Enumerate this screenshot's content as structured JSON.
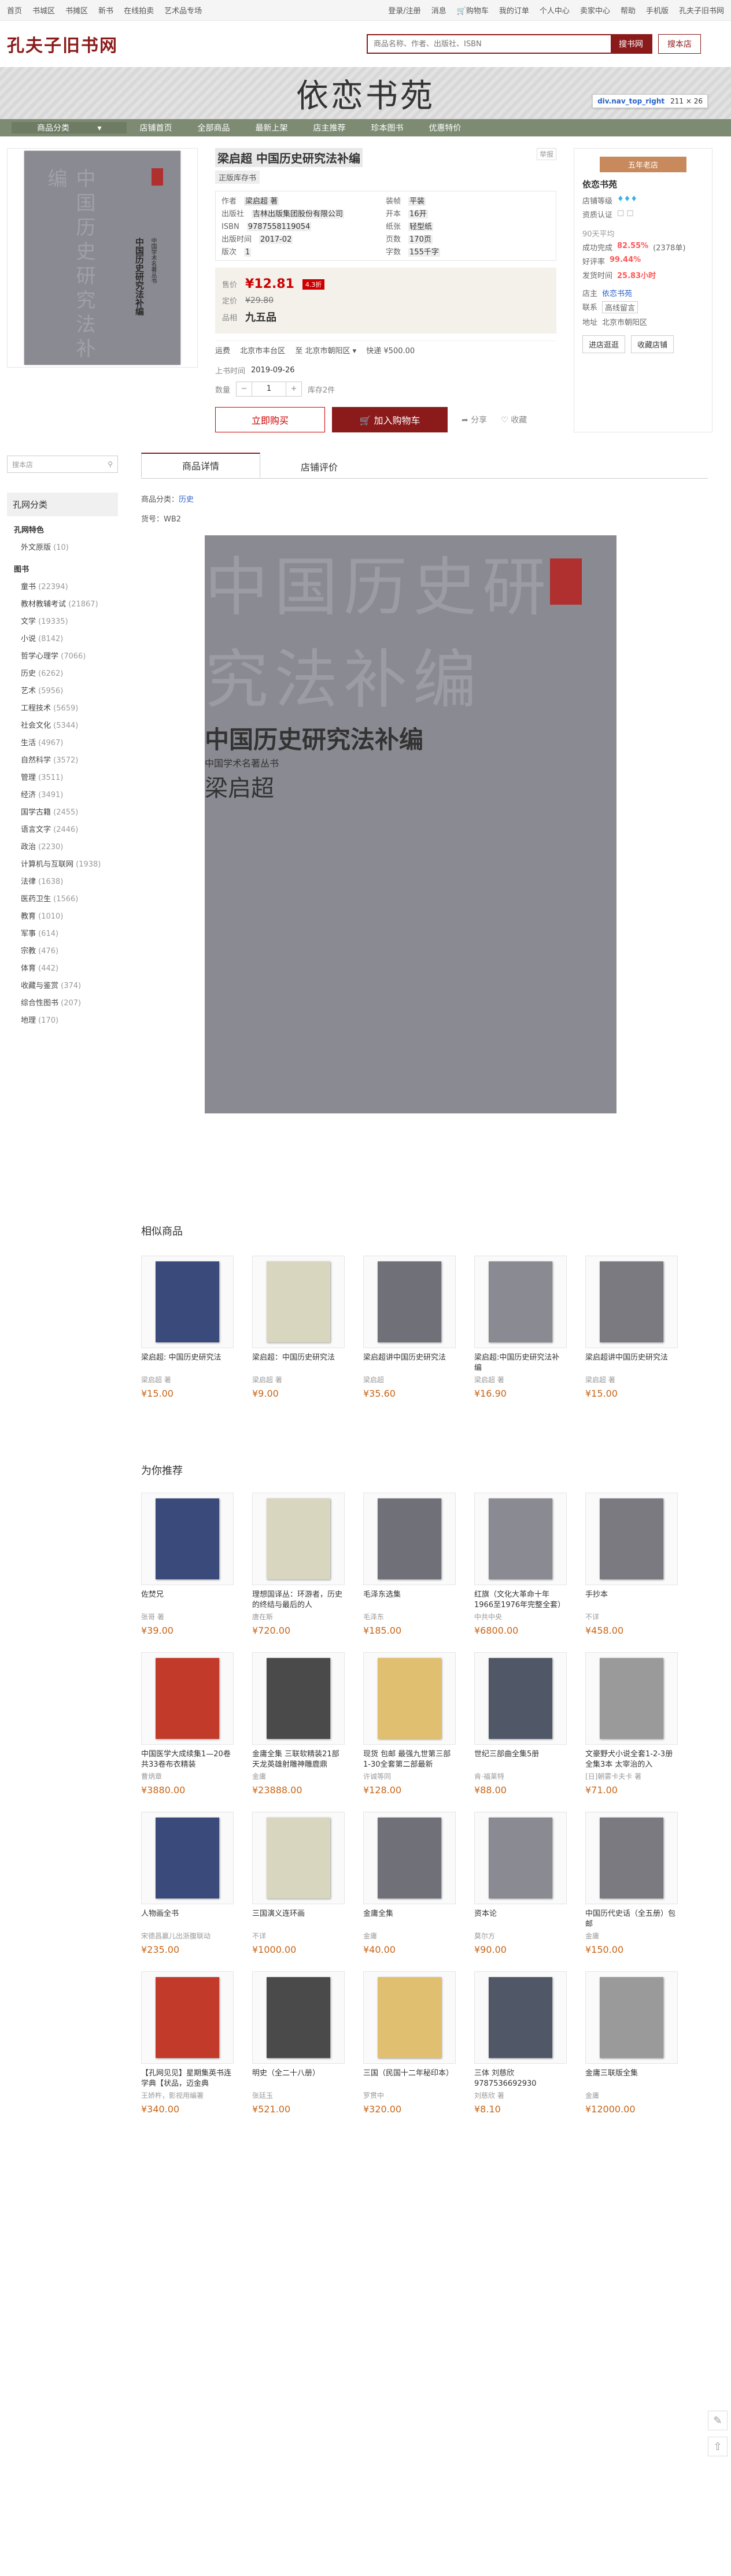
{
  "topbar": {
    "left": [
      "首页",
      "书城区",
      "书摊区",
      "新书",
      "在线拍卖",
      "艺术品专场"
    ],
    "right": [
      "登录/注册",
      "消息",
      "购物车",
      "我的订单",
      "个人中心",
      "卖家中心",
      "帮助",
      "手机版",
      "孔夫子旧书网"
    ]
  },
  "header": {
    "logo": "孔夫子旧书网",
    "search_placeholder": "商品名称、作者、出版社、ISBN",
    "search_btn": "搜书网",
    "shop_btn": "搜本店"
  },
  "shop_banner": {
    "name": "依恋书苑"
  },
  "nav": [
    "商品分类",
    "店铺首页",
    "全部商品",
    "最新上架",
    "店主推荐",
    "珍本图书",
    "优惠特价"
  ],
  "tooltip": {
    "name": "div.nav_top_right",
    "size": "211 × 26"
  },
  "book": {
    "title": "梁启超 中国历史研究法补编",
    "tag": "正版库存书",
    "report": "举报",
    "meta": [
      [
        "作者",
        "梁启超 著"
      ],
      [
        "装帧",
        "平装"
      ],
      [
        "出版社",
        "吉林出版集团股份有限公司"
      ],
      [
        "开本",
        "16开"
      ],
      [
        "ISBN",
        "9787558119054"
      ],
      [
        "纸张",
        "轻型纸"
      ],
      [
        "出版时间",
        "2017-02"
      ],
      [
        "页数",
        "170页"
      ],
      [
        "版次",
        "1"
      ],
      [
        "字数",
        "155千字"
      ]
    ],
    "price_label": "售价",
    "price": "¥12.81",
    "discount": "4.3折",
    "orig_label": "定价",
    "orig": "¥29.80",
    "quality_label": "品相",
    "quality": "九五品",
    "ship_label": "运费",
    "ship_from": "北京市丰台区",
    "ship_to": "至 北京市朝阳区",
    "ship_way": "快递 ¥500.00",
    "date_label": "上书时间",
    "date": "2019-09-26",
    "qty_label": "数量",
    "qty": "1",
    "stock": "库存2件",
    "buy": "立即购买",
    "cart": "加入购物车",
    "share": "分享",
    "fav": "收藏"
  },
  "shop": {
    "level": "五年老店",
    "name": "依恋书苑",
    "rating_label": "店铺等级",
    "cert_label": "资质认证",
    "sold": "90天平均",
    "r1": [
      "成功完成",
      "82.55%",
      "(2378单)"
    ],
    "r2": [
      "好评率",
      "99.44%"
    ],
    "r3": [
      "发货时间",
      "25.83小时"
    ],
    "addr_label": "地址",
    "addr": "北京市朝阳区",
    "contact_label": "联系",
    "contact": "高线留言",
    "loc_label": "店主",
    "loc": "依恋书苑",
    "btn1": "进店逛逛",
    "btn2": "收藏店铺"
  },
  "sidebar": {
    "search": "搜本店",
    "cat_title": "孔网分类",
    "special": "孔网特色",
    "special_items": [
      [
        "外文原版",
        "(10)"
      ]
    ],
    "books": "图书",
    "book_items": [
      [
        "童书",
        "(22394)"
      ],
      [
        "教材教辅考试",
        "(21867)"
      ],
      [
        "文学",
        "(19335)"
      ],
      [
        "小说",
        "(8142)"
      ],
      [
        "哲学心理学",
        "(7066)"
      ],
      [
        "历史",
        "(6262)"
      ],
      [
        "艺术",
        "(5956)"
      ],
      [
        "工程技术",
        "(5659)"
      ],
      [
        "社会文化",
        "(5344)"
      ],
      [
        "生活",
        "(4967)"
      ],
      [
        "自然科学",
        "(3572)"
      ],
      [
        "管理",
        "(3511)"
      ],
      [
        "经济",
        "(3491)"
      ],
      [
        "国学古籍",
        "(2455)"
      ],
      [
        "语言文字",
        "(2446)"
      ],
      [
        "政治",
        "(2230)"
      ],
      [
        "计算机与互联网",
        "(1938)"
      ],
      [
        "法律",
        "(1638)"
      ],
      [
        "医药卫生",
        "(1566)"
      ],
      [
        "教育",
        "(1010)"
      ],
      [
        "军事",
        "(614)"
      ],
      [
        "宗教",
        "(476)"
      ],
      [
        "体育",
        "(442)"
      ],
      [
        "收藏与鉴赏",
        "(374)"
      ],
      [
        "综合性图书",
        "(207)"
      ],
      [
        "地理",
        "(170)"
      ]
    ]
  },
  "tabs": [
    "商品详情",
    "店铺评价"
  ],
  "detail": {
    "cat_label": "商品分类：",
    "cat": "历史",
    "code": "货号：WB2"
  },
  "similar_title": "相似商品",
  "similar": [
    [
      "梁启超: 中国历史研究法",
      "梁启超 著",
      "¥15.00"
    ],
    [
      "梁启超：中国历史研究法",
      "梁启超 著",
      "¥9.00"
    ],
    [
      "梁启超讲中国历史研究法",
      "梁启超",
      "¥35.60"
    ],
    [
      "梁启超:中国历史研究法补编",
      "梁启超 著",
      "¥16.90"
    ],
    [
      "梁启超讲中国历史研究法",
      "梁启超 著",
      "¥15.00"
    ]
  ],
  "rec_title": "为你推荐",
  "rec": [
    [
      "佐焚兄",
      "张哥 著",
      "¥39.00"
    ],
    [
      "理想国译丛：环游者，历史的终结与最后的人",
      "唐在斯",
      "¥720.00"
    ],
    [
      "毛泽东选集",
      "毛泽东",
      "¥185.00"
    ],
    [
      "红旗（文化大革命十年1966至1976年完整全套）",
      "中共中央",
      "¥6800.00"
    ],
    [
      "手抄本",
      "不详",
      "¥458.00"
    ],
    [
      "中国医学大成续集1—20卷共33卷布衣精装",
      "曹炳章",
      "¥3880.00"
    ],
    [
      "金庸全集 三联软精装21部 天龙英雄射雕神雕鹿鼎",
      "金庸",
      "¥23888.00"
    ],
    [
      "现货 包邮 最强九世第三部1-30全套第二部最新",
      "许诚等同",
      "¥128.00"
    ],
    [
      "世纪三部曲全集5册",
      "肯·福莱特",
      "¥88.00"
    ],
    [
      "文豪野犬小说全套1-2-3册 全集3本 太宰治的入",
      "[日]朝雾卡夫卡 著",
      "¥71.00"
    ],
    [
      "人物画全书",
      "宋德昌赢儿出浙腹联动",
      "¥235.00"
    ],
    [
      "三国演义连环画",
      "不详",
      "¥1000.00"
    ],
    [
      "金庸全集",
      "金庸",
      "¥40.00"
    ],
    [
      "资本论",
      "莫尔方",
      "¥90.00"
    ],
    [
      "中国历代史话（全五册）包邮",
      "金庸",
      "¥150.00"
    ],
    [
      "【孔网见见】星期集英书连学典【状品，迈金典",
      "王娇杵，影视用编署",
      "¥340.00"
    ],
    [
      "明史（全二十八册）",
      "张廷玉",
      "¥521.00"
    ],
    [
      "三国（民国十二年秘印本）",
      "罗贯中",
      "¥320.00"
    ],
    [
      "三体 刘慈欣 9787536692930",
      "刘慈欣 著",
      "¥8.10"
    ],
    [
      "金庸三联版全集",
      "金庸",
      "¥12000.00"
    ]
  ]
}
